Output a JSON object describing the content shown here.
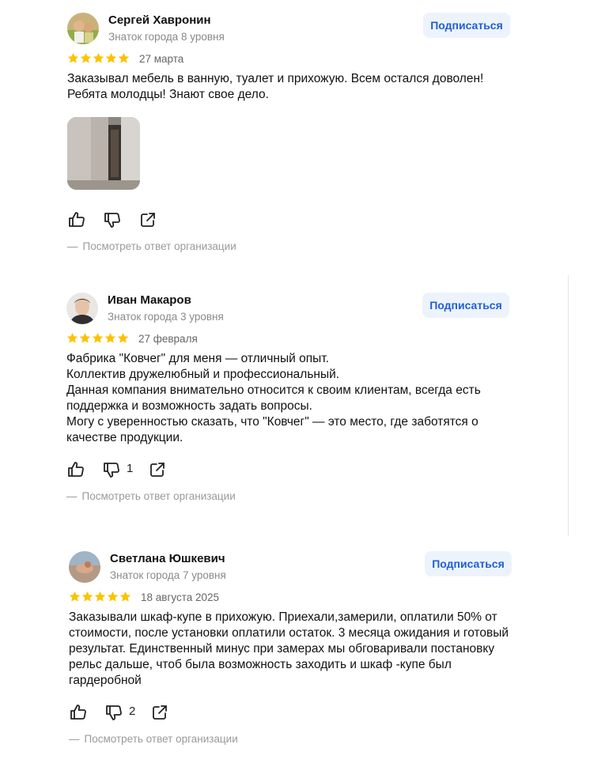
{
  "subscribe_label": "Подписаться",
  "org_response_label": "Посмотреть ответ организации",
  "star_color": "#fcc300",
  "accent_color": "#1f5fd6",
  "reviews": [
    {
      "author": "Сергей Хавронин",
      "level": "Знаток города 8 уровня",
      "rating": 5,
      "date": "27 марта",
      "text": "Заказывал мебель в ванную, туалет и прихожую. Всем остался доволен!\nРебята молодцы! Знают свое дело.",
      "has_photo": true,
      "dislikes": ""
    },
    {
      "author": "Иван Макаров",
      "level": "Знаток города 3 уровня",
      "rating": 5,
      "date": "27 февраля",
      "text": "Фабрика \"Ковчег\" для меня — отличный опыт.\nКоллектив дружелюбный и профессиональный.\nДанная компания внимательно относится к своим клиентам, всегда есть поддержка и возможность задать вопросы.\nМогу с уверенностью сказать, что \"Ковчег\" — это место, где заботятся о качестве продукции.",
      "has_photo": false,
      "dislikes": "1"
    },
    {
      "author": "Светлана Юшкевич",
      "level": "Знаток города 7 уровня",
      "rating": 5,
      "date": "18 августа 2025",
      "text": "Заказывали шкаф-купе в прихожую. Приехали,замерили, оплатили 50% от стоимости, после установки оплатили остаток. 3 месяца ожидания и готовый результат. Единственный минус при замерах мы обговаривали постановку рельс дальше, чтоб была возможность заходить и шкаф -купе был гардеробной",
      "has_photo": false,
      "dislikes": "2"
    }
  ]
}
